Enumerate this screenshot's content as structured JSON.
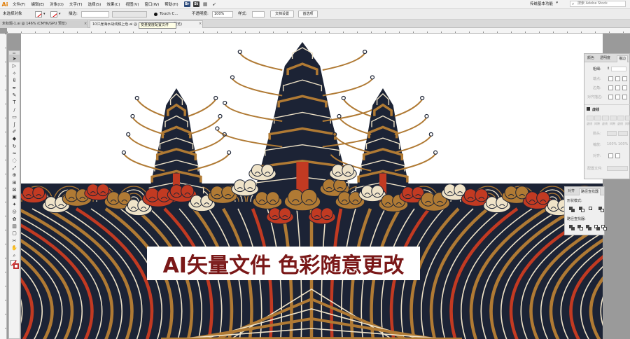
{
  "app": {
    "logo": "Ai"
  },
  "menu": {
    "items": [
      "文件(F)",
      "编辑(E)",
      "对象(O)",
      "文字(T)",
      "选择(S)",
      "效果(C)",
      "视图(V)",
      "窗口(W)",
      "帮助(H)"
    ],
    "bridge": "Br",
    "stock": "St",
    "workspace": "传统基本功能",
    "workspace_caret": "▾",
    "stock_search_placeholder": "搜索 Adobe Stock"
  },
  "control": {
    "selection": "未选择对象",
    "stroke_label": "描边:",
    "stroke_value": "",
    "brush_name": "Touch C...",
    "opacity_label": "不透明度:",
    "opacity_value": "100%",
    "style_label": "样式:",
    "doc_setup": "文档设置",
    "preferences": "首选项"
  },
  "tabs": [
    {
      "label": "未标题-1.ai @ 146% (CMYK/GPU 预览)",
      "close": "×"
    },
    {
      "label": "10江崖海水战线稿上色.ai @ 33.33% (CMYK/GPU 预览)",
      "close": "×"
    }
  ],
  "tooltip": "变量宽度配置文件",
  "banner": {
    "text": "AI矢量文件 色彩随意更改"
  },
  "colors": {
    "navy": "#1c2335",
    "ochre": "#b07a34",
    "red": "#c23a22",
    "cream": "#efe3c8",
    "banner_text": "#7a1818"
  },
  "tools_head": "▸▸",
  "tools": [
    "selection-tool",
    "direct-selection-tool",
    "magic-wand-tool",
    "lasso-tool",
    "pen-tool",
    "curvature-tool",
    "type-tool",
    "line-tool",
    "rectangle-tool",
    "paintbrush-tool",
    "shaper-tool",
    "eraser-tool",
    "rotate-tool",
    "width-tool",
    "warp-tool",
    "free-transform-tool",
    "shape-builder-tool",
    "perspective-grid-tool",
    "mesh-tool",
    "gradient-tool",
    "eyedropper-tool",
    "blend-tool",
    "symbol-sprayer-tool",
    "column-graph-tool",
    "artboard-tool",
    "slice-tool",
    "hand-tool",
    "zoom-tool"
  ],
  "tool_glyphs": [
    "➤",
    "▷",
    "✧",
    "ϐ",
    "✒",
    "✎",
    "T",
    "/",
    "▭",
    "ʃ",
    "✐",
    "◆",
    "↻",
    "≈",
    "◌",
    "⤢",
    "⊕",
    "⊞",
    "⊠",
    "▣",
    "✦",
    "◎",
    "✿",
    "▥",
    "▢",
    "✂",
    "✋",
    "⌕"
  ],
  "panels": {
    "stroke": {
      "tabs": [
        "颜色",
        "透明度",
        "描边"
      ],
      "weight_label": "粗细:",
      "cap_label": "端点:",
      "corner_label": "边角:",
      "align_label": "对齐描边:",
      "dashed_label": "虚线",
      "dash_labels": [
        "虚线",
        "间隙",
        "虚线",
        "间隙",
        "虚线",
        "间隙"
      ],
      "arrow_label": "箭头:",
      "scale_label": "缩放:",
      "scale_values": [
        "100%",
        "100%"
      ],
      "align2_label": "对齐:",
      "profile_label": "配置文件:"
    },
    "pathfinder": {
      "tabs": [
        "对齐",
        "路径查找器"
      ],
      "shape_modes": "形状模式:",
      "pathfinders": "路径查找器:"
    }
  }
}
